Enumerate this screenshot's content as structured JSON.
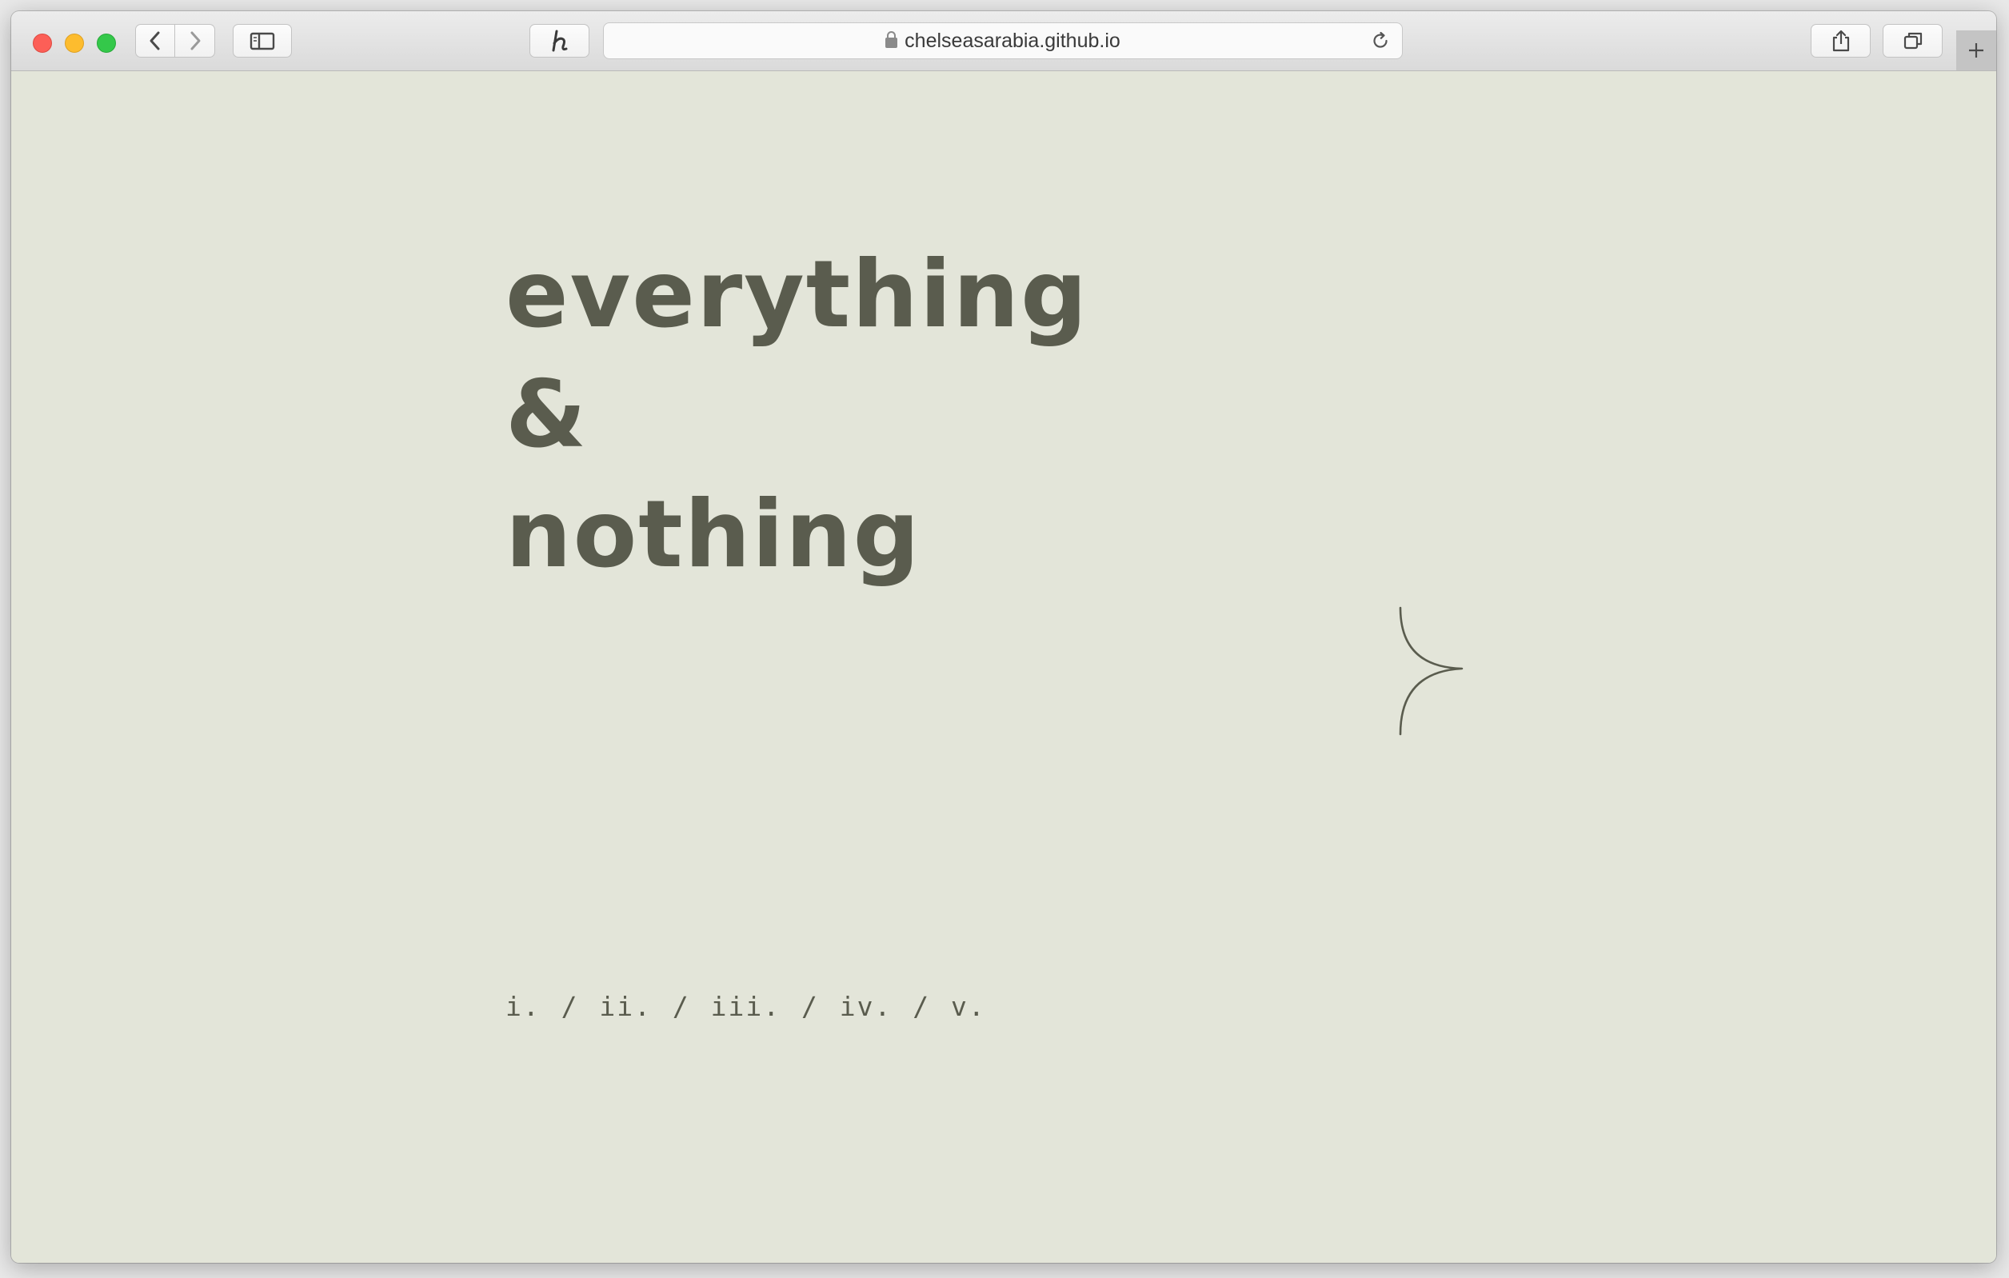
{
  "browser": {
    "url": "chelseasarabia.github.io",
    "icons": {
      "back": "chevron-left-icon",
      "forward": "chevron-right-icon",
      "sidebar": "sidebar-icon",
      "extension": "honey-h-icon",
      "lock": "lock-icon",
      "reload": "reload-icon",
      "share": "share-icon",
      "tabs": "tabs-overview-icon",
      "new_tab": "plus-icon"
    }
  },
  "page": {
    "title_lines": [
      "everything",
      "&",
      "nothing"
    ],
    "chapters": [
      "i.",
      "ii.",
      "iii.",
      "iv.",
      "v."
    ],
    "separator": "/",
    "colors": {
      "background": "#e3e5d9",
      "text": "#5a5c4e"
    }
  }
}
